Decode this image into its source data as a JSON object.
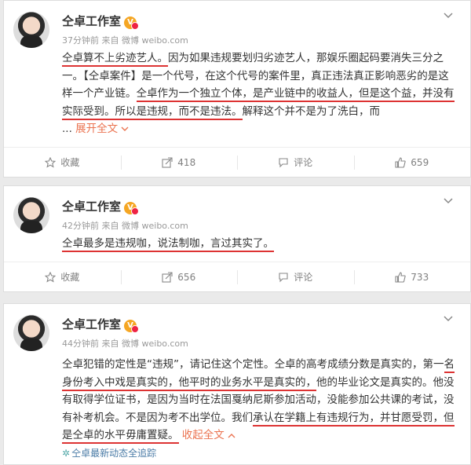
{
  "posts": [
    {
      "author": "仝卓工作室",
      "time": "37分钟前",
      "source_prefix": "来自",
      "source": "微博 weibo.com",
      "text_html": "<span class=\"u\">仝卓算不上劣迹艺人。</span>因为如果违规要划归劣迹艺人，那娱乐圈起码要消失三分之一。【仝卓案件】是一个代号，在这个代号的案件里，真正违法真正影响恶劣的是这样一个产业链。<span class=\"u\">仝卓作为一个独立个体，是产业链中的收益人，但是这个益，并没有实际受到。所以是违规，而不是违法。</span>解释这个并不是为了洗白，而",
      "ellipsis": "...",
      "expand": "展开全文",
      "actions": {
        "favorite": "收藏",
        "repost": "418",
        "comment": "评论",
        "like": "659"
      }
    },
    {
      "author": "仝卓工作室",
      "time": "42分钟前",
      "source_prefix": "来自",
      "source": "微博 weibo.com",
      "text_html": "<span class=\"u\">仝卓最多是违规咖，说法制咖，言过其实了。</span>",
      "actions": {
        "favorite": "收藏",
        "repost": "656",
        "comment": "评论",
        "like": "733"
      }
    },
    {
      "author": "仝卓工作室",
      "time": "44分钟前",
      "source_prefix": "来自",
      "source": "微博 weibo.com",
      "text_html": "仝卓犯错的定性是“违规”，请记住这个定性。仝卓的高考成绩分数是真实的，第一<span class=\"u\">名身份考入中戏是真实的，他平时的业务水平是真实的，</span>他的毕业论文是真实的。他没有取得学位证书，是因为当时在法国戛纳尼斯参加活动，没能参加公共课的考试，没有补考机会。不是因为考不出学位。我们<span class=\"u\">承认在学籍上有违规行为，并甘愿受罚，但是仝卓的水平毋庸置疑。</span>",
      "collapse": "收起全文",
      "follow": "仝卓最新动态全追踪",
      "actions": {}
    }
  ],
  "icons": {
    "badge": "vip-badge-icon",
    "chevron": "chevron-down-icon",
    "favorite": "star-icon",
    "repost": "share-icon",
    "comment": "comment-icon",
    "like": "thumbs-up-icon"
  },
  "colors": {
    "link": "#eb7350",
    "underline": "#dd3333",
    "muted": "#999999"
  }
}
